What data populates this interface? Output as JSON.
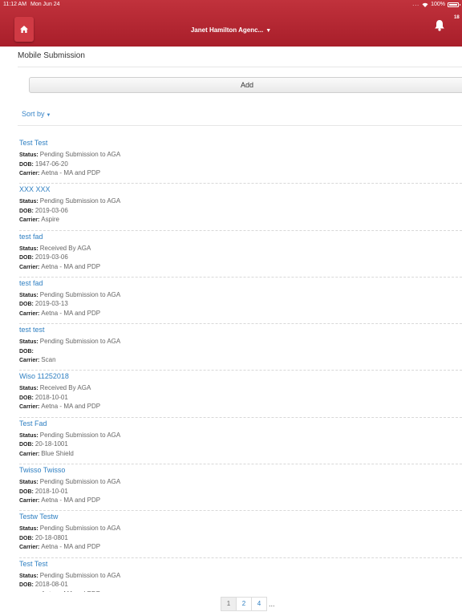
{
  "status_bar": {
    "time": "11:12 AM",
    "date": "Mon Jun 24",
    "dots": "...",
    "battery": "100%",
    "battery_level": 1.0
  },
  "header": {
    "agency": "Janet Hamilton Agenc...",
    "notification_count": "18",
    "colors": {
      "bar_top": "#c1323c",
      "bar_bottom": "#a81e2a",
      "home_button": "#d03a44"
    },
    "icons": {
      "home": "home-icon",
      "bell": "bell-icon",
      "dropdown": "chevron-down-icon"
    }
  },
  "page_title": "Mobile Submission",
  "add_button": "Add",
  "sort_by": "Sort by",
  "labels": {
    "status": "Status:",
    "dob": "DOB:",
    "carrier": "Carrier:"
  },
  "submissions": [
    {
      "name": "Test Test",
      "status": "Pending Submission to AGA",
      "dob": "1947-06-20",
      "carrier": "Aetna - MA and PDP"
    },
    {
      "name": "XXX XXX",
      "status": "Pending Submission to AGA",
      "dob": "2019-03-06",
      "carrier": "Aspire"
    },
    {
      "name": "test fad",
      "status": "Received By AGA",
      "dob": "2019-03-06",
      "carrier": "Aetna - MA and PDP"
    },
    {
      "name": "test fad",
      "status": "Pending Submission to AGA",
      "dob": "2019-03-13",
      "carrier": "Aetna - MA and PDP"
    },
    {
      "name": "test test",
      "status": "Pending Submission to AGA",
      "dob": "",
      "carrier": "Scan"
    },
    {
      "name": "Wiso 11252018",
      "status": "Received By AGA",
      "dob": "2018-10-01",
      "carrier": "Aetna - MA and PDP"
    },
    {
      "name": "Test Fad",
      "status": "Pending Submission to AGA",
      "dob": "20-18-1001",
      "carrier": "Blue Shield"
    },
    {
      "name": "Twisso Twisso",
      "status": "Pending Submission to AGA",
      "dob": "2018-10-01",
      "carrier": "Aetna - MA and PDP"
    },
    {
      "name": "Testw Testw",
      "status": "Pending Submission to AGA",
      "dob": "20-18-0801",
      "carrier": "Aetna - MA and PDP"
    },
    {
      "name": "Test Test",
      "status": "Pending Submission to AGA",
      "dob": "2018-08-01",
      "carrier": "Aetna - MA and PDP"
    }
  ],
  "pagination": {
    "pages": [
      "1",
      "2",
      "4"
    ],
    "current": "1",
    "ellipsis": "..."
  }
}
